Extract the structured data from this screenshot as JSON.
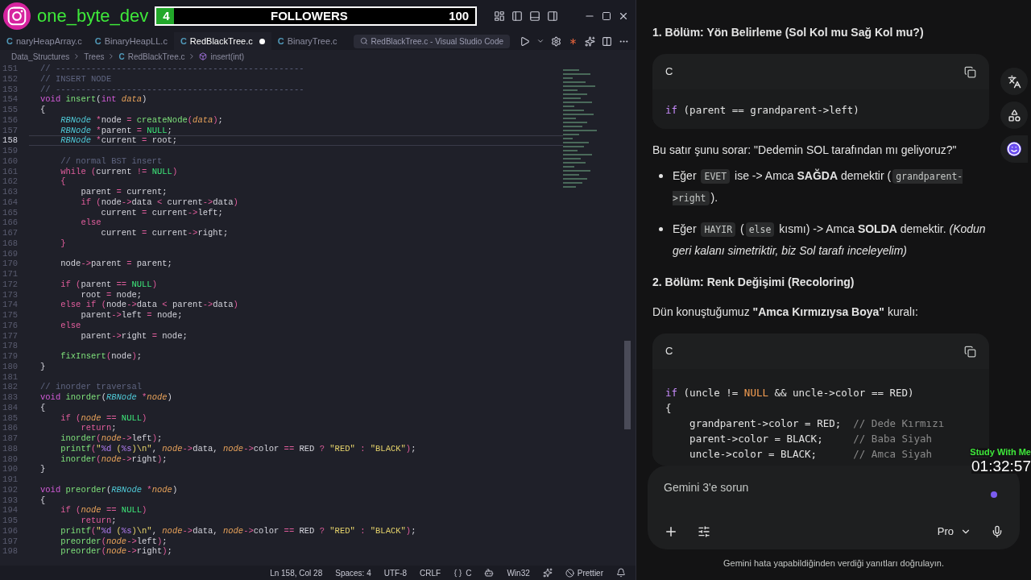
{
  "stream_overlay": {
    "handle": "one_byte_dev",
    "followers": {
      "count": "4",
      "label": "FOLLOWERS",
      "goal": "100",
      "level": 0.04
    },
    "timer": {
      "label": "Study With Me",
      "time": "01:32:57"
    }
  },
  "editor": {
    "title": "RedBlackTree.c - Visual Studio Code",
    "tabs": [
      {
        "lang": "C",
        "label": "naryHeapArray.c",
        "selected": false,
        "modified": false
      },
      {
        "lang": "C",
        "label": "BinaryHeapLL.c",
        "selected": false,
        "modified": false
      },
      {
        "lang": "C",
        "label": "RedBlackTree.c",
        "selected": true,
        "modified": true
      },
      {
        "lang": "C",
        "label": "BinaryTree.c",
        "selected": false,
        "modified": false
      }
    ],
    "breadcrumbs": [
      {
        "kind": "folder",
        "text": "Data_Structures"
      },
      {
        "kind": "folder",
        "text": "Trees"
      },
      {
        "kind": "file",
        "lang": "C",
        "text": "RedBlackTree.c"
      },
      {
        "kind": "symbol",
        "text": "insert(int)"
      }
    ],
    "lines": [
      {
        "no": "151",
        "current": false,
        "tokens": [
          {
            "kind": "comment",
            "text": "// -------------------------------------------------"
          }
        ]
      },
      {
        "no": "152",
        "current": false,
        "tokens": [
          {
            "kind": "comment",
            "text": "// INSERT NODE"
          }
        ]
      },
      {
        "no": "153",
        "current": false,
        "tokens": [
          {
            "kind": "comment",
            "text": "// -------------------------------------------------"
          }
        ]
      },
      {
        "no": "154",
        "current": false,
        "tokens": [
          {
            "kind": "type",
            "text": "void "
          },
          {
            "kind": "function",
            "text": "insert"
          },
          {
            "text": "("
          },
          {
            "kind": "type",
            "text": "int "
          },
          {
            "kind": "param",
            "text": "data"
          },
          {
            "text": ")"
          }
        ]
      },
      {
        "no": "155",
        "current": false,
        "tokens": [
          {
            "text": "{"
          }
        ]
      },
      {
        "no": "156",
        "current": false,
        "tokens": [
          {
            "kind": "class",
            "text": "    RBNode "
          },
          {
            "kind": "operator",
            "text": "*"
          },
          {
            "text": "node "
          },
          {
            "kind": "operator",
            "text": "= "
          },
          {
            "kind": "function",
            "text": "createNode"
          },
          {
            "kind": "operator",
            "text": "("
          },
          {
            "kind": "param",
            "text": "data"
          },
          {
            "kind": "operator",
            "text": ")"
          },
          {
            "text": ";"
          }
        ]
      },
      {
        "no": "157",
        "current": false,
        "tokens": [
          {
            "kind": "class",
            "text": "    RBNode "
          },
          {
            "kind": "operator",
            "text": "*"
          },
          {
            "text": "parent "
          },
          {
            "kind": "operator",
            "text": "= "
          },
          {
            "kind": "constant",
            "text": "NULL"
          },
          {
            "text": ";"
          }
        ]
      },
      {
        "no": "158",
        "current": true,
        "tokens": [
          {
            "kind": "class",
            "text": "    RBNode "
          },
          {
            "kind": "operator",
            "text": "*"
          },
          {
            "text": "current "
          },
          {
            "kind": "operator",
            "text": "="
          },
          {
            "text": " root;"
          }
        ]
      },
      {
        "no": "159",
        "current": false
      },
      {
        "no": "160",
        "current": false,
        "tokens": [
          {
            "kind": "comment",
            "text": "    // normal BST insert"
          }
        ]
      },
      {
        "no": "161",
        "current": false,
        "tokens": [
          {
            "kind": "keyword",
            "text": "    while "
          },
          {
            "kind": "operator",
            "text": "("
          },
          {
            "text": "current "
          },
          {
            "kind": "operator",
            "text": "!= "
          },
          {
            "kind": "constant",
            "text": "NULL"
          },
          {
            "kind": "operator",
            "text": ")"
          }
        ]
      },
      {
        "no": "162",
        "current": false,
        "tokens": [
          {
            "kind": "operator",
            "text": "    {"
          }
        ]
      },
      {
        "no": "163",
        "current": false,
        "tokens": [
          {
            "text": "        parent "
          },
          {
            "kind": "operator",
            "text": "="
          },
          {
            "text": " current;"
          }
        ]
      },
      {
        "no": "164",
        "current": false,
        "tokens": [
          {
            "kind": "keyword",
            "text": "        if "
          },
          {
            "kind": "operator",
            "text": "("
          },
          {
            "text": "node"
          },
          {
            "kind": "operator",
            "text": "->"
          },
          {
            "text": "data "
          },
          {
            "kind": "operator",
            "text": "<"
          },
          {
            "text": " current"
          },
          {
            "kind": "operator",
            "text": "->"
          },
          {
            "text": "data"
          },
          {
            "kind": "operator",
            "text": ")"
          }
        ]
      },
      {
        "no": "165",
        "current": false,
        "tokens": [
          {
            "text": "            current "
          },
          {
            "kind": "operator",
            "text": "="
          },
          {
            "text": " current"
          },
          {
            "kind": "operator",
            "text": "->"
          },
          {
            "text": "left;"
          }
        ]
      },
      {
        "no": "166",
        "current": false,
        "tokens": [
          {
            "kind": "keyword",
            "text": "        else"
          }
        ]
      },
      {
        "no": "167",
        "current": false,
        "tokens": [
          {
            "text": "            current "
          },
          {
            "kind": "operator",
            "text": "="
          },
          {
            "text": " current"
          },
          {
            "kind": "operator",
            "text": "->"
          },
          {
            "text": "right;"
          }
        ]
      },
      {
        "no": "168",
        "current": false,
        "tokens": [
          {
            "kind": "operator",
            "text": "    }"
          }
        ]
      },
      {
        "no": "169",
        "current": false
      },
      {
        "no": "170",
        "current": false,
        "tokens": [
          {
            "text": "    node"
          },
          {
            "kind": "operator",
            "text": "->"
          },
          {
            "text": "parent "
          },
          {
            "kind": "operator",
            "text": "="
          },
          {
            "text": " parent;"
          }
        ]
      },
      {
        "no": "171",
        "current": false
      },
      {
        "no": "172",
        "current": false,
        "tokens": [
          {
            "kind": "keyword",
            "text": "    if "
          },
          {
            "kind": "operator",
            "text": "("
          },
          {
            "text": "parent "
          },
          {
            "kind": "operator",
            "text": "== "
          },
          {
            "kind": "constant",
            "text": "NULL"
          },
          {
            "kind": "operator",
            "text": ")"
          }
        ]
      },
      {
        "no": "173",
        "current": false,
        "tokens": [
          {
            "text": "        root "
          },
          {
            "kind": "operator",
            "text": "="
          },
          {
            "text": " node;"
          }
        ]
      },
      {
        "no": "174",
        "current": false,
        "tokens": [
          {
            "kind": "keyword",
            "text": "    else if "
          },
          {
            "kind": "operator",
            "text": "("
          },
          {
            "text": "node"
          },
          {
            "kind": "operator",
            "text": "->"
          },
          {
            "text": "data "
          },
          {
            "kind": "operator",
            "text": "<"
          },
          {
            "text": " parent"
          },
          {
            "kind": "operator",
            "text": "->"
          },
          {
            "text": "data"
          },
          {
            "kind": "operator",
            "text": ")"
          }
        ]
      },
      {
        "no": "175",
        "current": false,
        "tokens": [
          {
            "text": "        parent"
          },
          {
            "kind": "operator",
            "text": "->"
          },
          {
            "text": "left "
          },
          {
            "kind": "operator",
            "text": "="
          },
          {
            "text": " node;"
          }
        ]
      },
      {
        "no": "176",
        "current": false,
        "tokens": [
          {
            "kind": "keyword",
            "text": "    else"
          }
        ]
      },
      {
        "no": "177",
        "current": false,
        "tokens": [
          {
            "text": "        parent"
          },
          {
            "kind": "operator",
            "text": "->"
          },
          {
            "text": "right "
          },
          {
            "kind": "operator",
            "text": "="
          },
          {
            "text": " node;"
          }
        ]
      },
      {
        "no": "178",
        "current": false
      },
      {
        "no": "179",
        "current": false,
        "tokens": [
          {
            "kind": "function",
            "text": "    fixInsert"
          },
          {
            "kind": "operator",
            "text": "("
          },
          {
            "text": "node"
          },
          {
            "kind": "operator",
            "text": ")"
          },
          {
            "text": ";"
          }
        ]
      },
      {
        "no": "180",
        "current": false,
        "tokens": [
          {
            "text": "}"
          }
        ]
      },
      {
        "no": "181",
        "current": false
      },
      {
        "no": "182",
        "current": false,
        "tokens": [
          {
            "kind": "comment",
            "text": "// inorder traversal"
          }
        ]
      },
      {
        "no": "183",
        "current": false,
        "tokens": [
          {
            "kind": "type",
            "text": "void "
          },
          {
            "kind": "function",
            "text": "inorder"
          },
          {
            "text": "("
          },
          {
            "kind": "class",
            "text": "RBNode "
          },
          {
            "kind": "operator",
            "text": "*"
          },
          {
            "kind": "param",
            "text": "node"
          },
          {
            "text": ")"
          }
        ]
      },
      {
        "no": "184",
        "current": false,
        "tokens": [
          {
            "text": "{"
          }
        ]
      },
      {
        "no": "185",
        "current": false,
        "tokens": [
          {
            "kind": "keyword",
            "text": "    if "
          },
          {
            "kind": "operator",
            "text": "("
          },
          {
            "kind": "param",
            "text": "node "
          },
          {
            "kind": "operator",
            "text": "== "
          },
          {
            "kind": "constant",
            "text": "NULL"
          },
          {
            "kind": "operator",
            "text": ")"
          }
        ]
      },
      {
        "no": "186",
        "current": false,
        "tokens": [
          {
            "kind": "keyword",
            "text": "        return"
          },
          {
            "text": ";"
          }
        ]
      },
      {
        "no": "187",
        "current": false,
        "tokens": [
          {
            "kind": "function",
            "text": "    inorder"
          },
          {
            "kind": "operator",
            "text": "("
          },
          {
            "kind": "param",
            "text": "node"
          },
          {
            "kind": "operator",
            "text": "->"
          },
          {
            "text": "left"
          },
          {
            "kind": "operator",
            "text": ")"
          },
          {
            "text": ";"
          }
        ]
      },
      {
        "no": "188",
        "current": false,
        "tokens": [
          {
            "kind": "function",
            "text": "    printf"
          },
          {
            "kind": "operator",
            "text": "("
          },
          {
            "kind": "string",
            "text": "\""
          },
          {
            "kind": "format",
            "text": "%d"
          },
          {
            "kind": "string",
            "text": " ("
          },
          {
            "kind": "format",
            "text": "%s"
          },
          {
            "kind": "string",
            "text": ")\\n\""
          },
          {
            "text": ", "
          },
          {
            "kind": "param",
            "text": "node"
          },
          {
            "kind": "operator",
            "text": "->"
          },
          {
            "text": "data, "
          },
          {
            "kind": "param",
            "text": "node"
          },
          {
            "kind": "operator",
            "text": "->"
          },
          {
            "text": "color "
          },
          {
            "kind": "operator",
            "text": "=="
          },
          {
            "text": " RED "
          },
          {
            "kind": "operator",
            "text": "? "
          },
          {
            "kind": "string",
            "text": "\"RED\" "
          },
          {
            "kind": "operator",
            "text": ": "
          },
          {
            "kind": "string",
            "text": "\"BLACK\""
          },
          {
            "kind": "operator",
            "text": ")"
          },
          {
            "text": ";"
          }
        ]
      },
      {
        "no": "189",
        "current": false,
        "tokens": [
          {
            "kind": "function",
            "text": "    inorder"
          },
          {
            "kind": "operator",
            "text": "("
          },
          {
            "kind": "param",
            "text": "node"
          },
          {
            "kind": "operator",
            "text": "->"
          },
          {
            "text": "right"
          },
          {
            "kind": "operator",
            "text": ")"
          },
          {
            "text": ";"
          }
        ]
      },
      {
        "no": "190",
        "current": false,
        "tokens": [
          {
            "text": "}"
          }
        ]
      },
      {
        "no": "191",
        "current": false
      },
      {
        "no": "192",
        "current": false,
        "tokens": [
          {
            "kind": "type",
            "text": "void "
          },
          {
            "kind": "function",
            "text": "preorder"
          },
          {
            "text": "("
          },
          {
            "kind": "class",
            "text": "RBNode "
          },
          {
            "kind": "operator",
            "text": "*"
          },
          {
            "kind": "param",
            "text": "node"
          },
          {
            "text": ")"
          }
        ]
      },
      {
        "no": "193",
        "current": false,
        "tokens": [
          {
            "text": "{"
          }
        ]
      },
      {
        "no": "194",
        "current": false,
        "tokens": [
          {
            "kind": "keyword",
            "text": "    if "
          },
          {
            "kind": "operator",
            "text": "("
          },
          {
            "kind": "param",
            "text": "node "
          },
          {
            "kind": "operator",
            "text": "== "
          },
          {
            "kind": "constant",
            "text": "NULL"
          },
          {
            "kind": "operator",
            "text": ")"
          }
        ]
      },
      {
        "no": "195",
        "current": false,
        "tokens": [
          {
            "kind": "keyword",
            "text": "        return"
          },
          {
            "text": ";"
          }
        ]
      },
      {
        "no": "196",
        "current": false,
        "tokens": [
          {
            "kind": "function",
            "text": "    printf"
          },
          {
            "kind": "operator",
            "text": "("
          },
          {
            "kind": "string",
            "text": "\""
          },
          {
            "kind": "format",
            "text": "%d"
          },
          {
            "kind": "string",
            "text": " ("
          },
          {
            "kind": "format",
            "text": "%s"
          },
          {
            "kind": "string",
            "text": ")\\n\""
          },
          {
            "text": ", "
          },
          {
            "kind": "param",
            "text": "node"
          },
          {
            "kind": "operator",
            "text": "->"
          },
          {
            "text": "data, "
          },
          {
            "kind": "param",
            "text": "node"
          },
          {
            "kind": "operator",
            "text": "->"
          },
          {
            "text": "color "
          },
          {
            "kind": "operator",
            "text": "=="
          },
          {
            "text": " RED "
          },
          {
            "kind": "operator",
            "text": "? "
          },
          {
            "kind": "string",
            "text": "\"RED\" "
          },
          {
            "kind": "operator",
            "text": ": "
          },
          {
            "kind": "string",
            "text": "\"BLACK\""
          },
          {
            "kind": "operator",
            "text": ")"
          },
          {
            "text": ";"
          }
        ]
      },
      {
        "no": "197",
        "current": false,
        "tokens": [
          {
            "kind": "function",
            "text": "    preorder"
          },
          {
            "kind": "operator",
            "text": "("
          },
          {
            "kind": "param",
            "text": "node"
          },
          {
            "kind": "operator",
            "text": "->"
          },
          {
            "text": "left"
          },
          {
            "kind": "operator",
            "text": ")"
          },
          {
            "text": ";"
          }
        ]
      },
      {
        "no": "198",
        "current": false,
        "tokens": [
          {
            "kind": "function",
            "text": "    preorder"
          },
          {
            "kind": "operator",
            "text": "("
          },
          {
            "kind": "param",
            "text": "node"
          },
          {
            "kind": "operator",
            "text": "->"
          },
          {
            "text": "right"
          },
          {
            "kind": "operator",
            "text": ")"
          },
          {
            "text": ";"
          }
        ]
      }
    ],
    "status_bar": [
      {
        "kind": "plain",
        "text": "Ln 158, Col 28"
      },
      {
        "kind": "plain",
        "text": "Spaces: 4"
      },
      {
        "kind": "plain",
        "text": "UTF-8"
      },
      {
        "kind": "plain",
        "text": "CRLF"
      },
      {
        "kind": "language",
        "text": "C"
      },
      {
        "kind": "platform",
        "text": "Win32"
      },
      {
        "kind": "formatter",
        "text": "Prettier"
      }
    ]
  },
  "chat": {
    "blocks": [
      {
        "kind": "heading",
        "text": "1. Bölüm: Yön Belirleme (Sol Kol mu Sağ Kol mu?)"
      },
      {
        "kind": "code",
        "lang": "C",
        "lines": [
          [
            {
              "kind": "keyword",
              "text": "if"
            },
            {
              "text": " (parent == grandparent->left)"
            }
          ]
        ]
      },
      {
        "kind": "paragraph",
        "text": "Bu satır şunu sorar: \"Dedemin SOL tarafından mı geliyoruz?\""
      },
      {
        "kind": "bullets",
        "items": [
          [
            {
              "kind": "text",
              "text": "Eğer "
            },
            {
              "kind": "code",
              "text": "EVET"
            },
            {
              "kind": "text",
              "text": " ise -> Amca **SAĞDA** demektir ("
            },
            {
              "kind": "code",
              "text": "grandparent->right"
            },
            {
              "kind": "text",
              "text": ")."
            }
          ],
          [
            {
              "kind": "text",
              "text": "Eğer "
            },
            {
              "kind": "code",
              "text": "HAYIR"
            },
            {
              "kind": "text",
              "text": " ("
            },
            {
              "kind": "code",
              "text": "else"
            },
            {
              "kind": "text",
              "text": " kısmı) -> Amca **SOLDA** demektir. *(Kodun geri kalanı simetriktir, biz Sol tarafı inceleyelim)*"
            }
          ]
        ]
      },
      {
        "kind": "heading",
        "text": "2. Bölüm: Renk Değişimi (Recoloring)"
      },
      {
        "kind": "paragraph",
        "text": "Dün konuştuğumuz **\"Amca Kırmızıysa Boya\"** kuralı:"
      },
      {
        "kind": "code",
        "lang": "C",
        "lines": [
          [
            {
              "kind": "keyword",
              "text": "if"
            },
            {
              "text": " (uncle != "
            },
            {
              "kind": "constant",
              "text": "NULL"
            },
            {
              "text": " && uncle->color == RED)"
            }
          ],
          [
            {
              "text": "{"
            }
          ],
          [
            {
              "text": "    grandparent->color = RED;  "
            },
            {
              "kind": "comment",
              "text": "// Dede Kırmızı"
            }
          ],
          [
            {
              "text": "    parent->color = BLACK;     "
            },
            {
              "kind": "comment",
              "text": "// Baba Siyah"
            }
          ],
          [
            {
              "text": "    uncle->color = BLACK;      "
            },
            {
              "kind": "comment",
              "text": "// Amca Siyah"
            }
          ]
        ]
      }
    ],
    "input": {
      "placeholder": "Gemini 3'e sorun",
      "model": "Pro"
    },
    "disclaimer": "Gemini hata yapabildiğinden verdiği yanıtları doğrulayın."
  }
}
